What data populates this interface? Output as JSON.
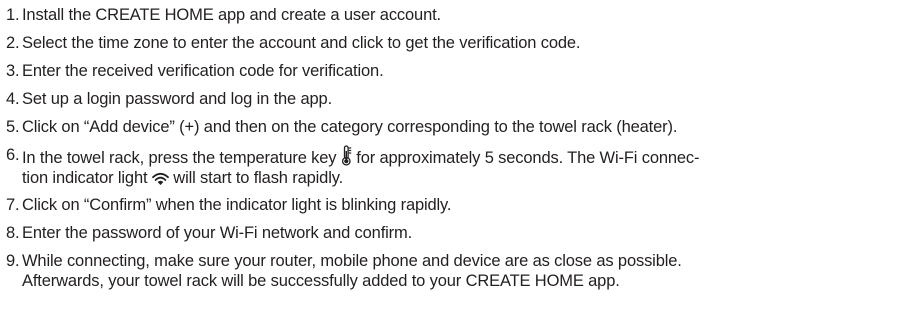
{
  "steps": [
    {
      "num": "1.",
      "text": "Install the CREATE HOME app and create a user account."
    },
    {
      "num": "2.",
      "text": "Select the time zone to enter the account and click to get the verification code."
    },
    {
      "num": "3.",
      "text": "Enter the received verification code for verification."
    },
    {
      "num": "4.",
      "text": "Set up a login password and log in the app."
    },
    {
      "num": "5.",
      "text": "Click on “Add device” (+) and then on the category corresponding to the towel rack (heater)."
    },
    {
      "num": "6.",
      "text_a": "In the towel rack, press the temperature key",
      "icon_a": "thermometer-icon",
      "text_b": "for approximately 5 seconds. The Wi-Fi connec-",
      "text_c": "tion indicator light",
      "icon_b": "wifi-icon",
      "text_d": "will start to flash rapidly."
    },
    {
      "num": "7.",
      "text": "Click on “Confirm” when the indicator light is blinking rapidly."
    },
    {
      "num": "8.",
      "text": "Enter the password of your Wi-Fi network and confirm."
    },
    {
      "num": "9.",
      "line1": "While connecting, make sure your router, mobile phone and device are as close as possible.",
      "line2": "Afterwards, your towel rack will be successfully added to your CREATE HOME app."
    }
  ]
}
